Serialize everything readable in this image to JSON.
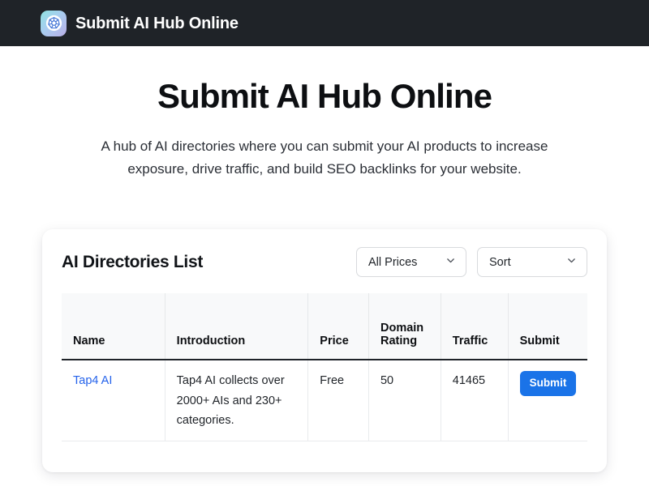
{
  "navbar": {
    "logo_icon": "kubernetes-helm-wheel-icon",
    "brand_title": "Submit AI Hub Online"
  },
  "hero": {
    "title": "Submit AI Hub Online",
    "subtitle": "A hub of AI directories where you can submit your AI products to increase exposure, drive traffic, and build SEO backlinks for your website."
  },
  "listing": {
    "title": "AI Directories List",
    "filters": {
      "price_filter_value": "All Prices",
      "sort_value": "Sort",
      "chevron": "⌄"
    },
    "columns": [
      "Name",
      "Introduction",
      "Price",
      "Domain Rating",
      "Traffic",
      "Submit"
    ],
    "rows": [
      {
        "name": "Tap4 AI",
        "introduction": "Tap4 AI collects over 2000+ AIs and 230+ categories.",
        "price": "Free",
        "domain_rating": "50",
        "traffic": "41465",
        "submit_label": "Submit"
      }
    ]
  },
  "colors": {
    "navbar_bg": "#1f2328",
    "link_blue": "#2563eb",
    "button_blue": "#1a73e8",
    "table_header_bg": "#f8f9fa",
    "page_bg": "#ffffff"
  }
}
